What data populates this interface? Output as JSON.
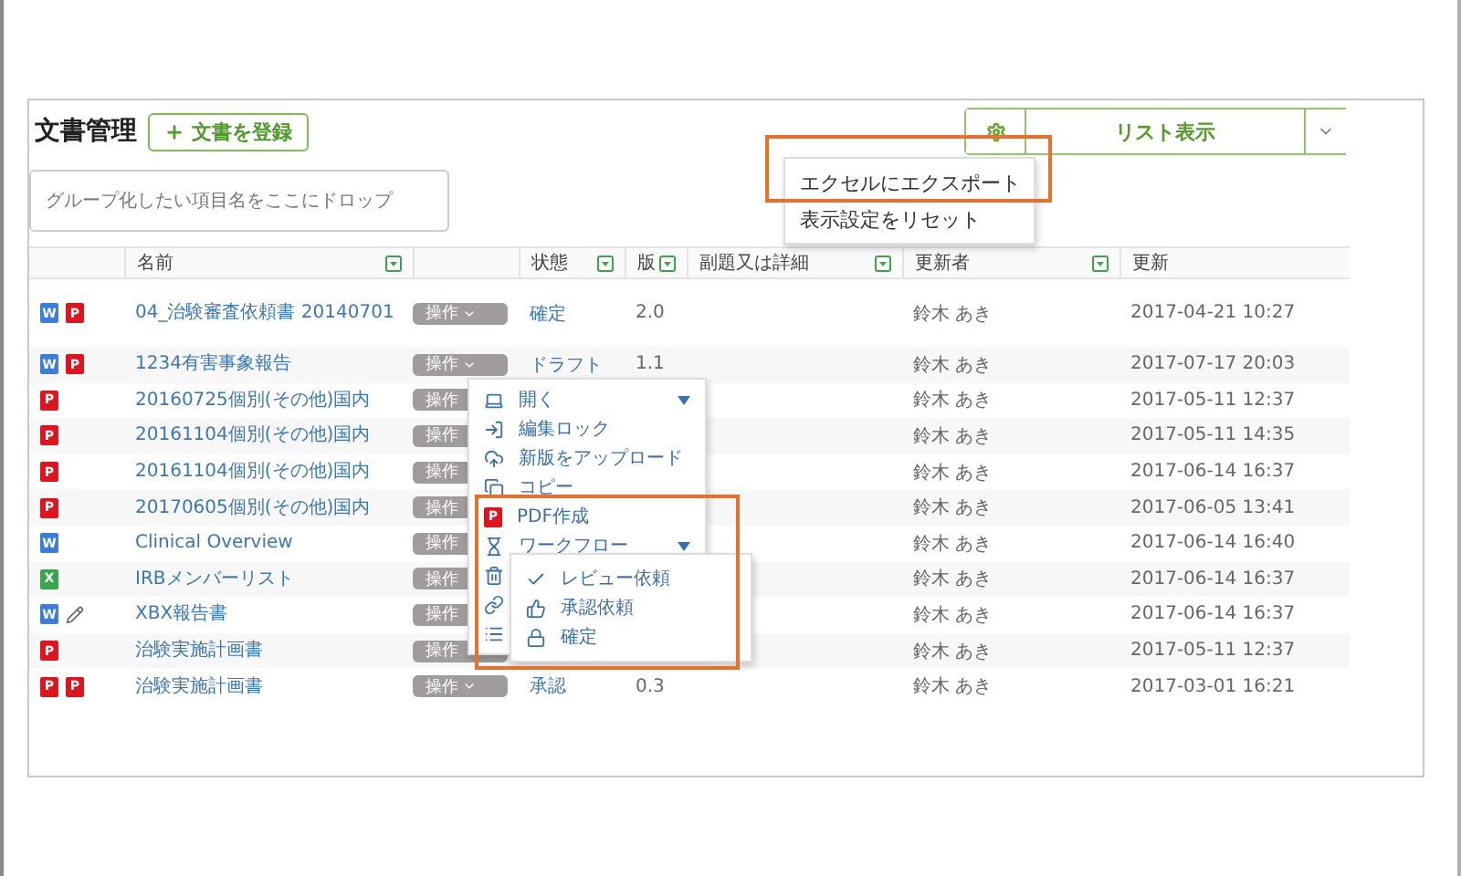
{
  "title": "文書管理",
  "register_button": {
    "label": "文書を登録"
  },
  "view_selector": {
    "label": "リスト表示"
  },
  "view_menu": {
    "items": [
      {
        "label": "エクセルにエクスポート",
        "highlighted": true
      },
      {
        "label": "表示設定をリセット",
        "highlighted": false
      }
    ]
  },
  "group_drop_zone": {
    "placeholder": "グループ化したい項目名をここにドロップ"
  },
  "table": {
    "columns": [
      {
        "filter": false
      },
      {
        "label": "名前",
        "filter": true
      },
      {
        "filter": false
      },
      {
        "label": "状態",
        "filter": true
      },
      {
        "label": "版",
        "filter": true
      },
      {
        "label": "副題又は詳細",
        "filter": true
      },
      {
        "label": "更新者",
        "filter": true
      },
      {
        "label": "更新",
        "filter": false
      }
    ],
    "rows": [
      {
        "files": [
          {
            "kind": "word",
            "letter": "W"
          },
          {
            "kind": "pdf",
            "letter": "P"
          }
        ],
        "name": "04_治験審査依頼書 20140701",
        "action": "操作",
        "status": "確定",
        "version": "2.0",
        "updater": "鈴木 あき",
        "updated": "2017-04-21 10:27"
      },
      {
        "files": [
          {
            "kind": "word",
            "letter": "W"
          },
          {
            "kind": "pdf",
            "letter": "P"
          }
        ],
        "name": "1234有害事象報告",
        "action": "操作",
        "status": "ドラフト",
        "version": "1.1",
        "updater": "鈴木 あき",
        "updated": "2017-07-17 20:03"
      },
      {
        "files": [
          {
            "kind": "pdf",
            "letter": "P"
          }
        ],
        "name": "20160725個別(その他)国内",
        "action": "操作",
        "updater": "鈴木 あき",
        "updated": "2017-05-11 12:37"
      },
      {
        "files": [
          {
            "kind": "pdf",
            "letter": "P"
          }
        ],
        "name": "20161104個別(その他)国内",
        "action": "操作",
        "updater": "鈴木 あき",
        "updated": "2017-05-11 14:35"
      },
      {
        "files": [
          {
            "kind": "pdf",
            "letter": "P"
          }
        ],
        "name": "20161104個別(その他)国内",
        "action": "操作",
        "updater": "鈴木 あき",
        "updated": "2017-06-14 16:37"
      },
      {
        "files": [
          {
            "kind": "pdf",
            "letter": "P"
          }
        ],
        "name": "20170605個別(その他)国内",
        "action": "操作",
        "updater": "鈴木 あき",
        "updated": "2017-06-05 13:41"
      },
      {
        "files": [
          {
            "kind": "word",
            "letter": "W"
          }
        ],
        "name": "Clinical Overview",
        "action": "操作",
        "updater": "鈴木 あき",
        "updated": "2017-06-14 16:40"
      },
      {
        "files": [
          {
            "kind": "excel",
            "letter": "X"
          }
        ],
        "name": "IRBメンバーリスト",
        "action": "操作",
        "updater": "鈴木 あき",
        "updated": "2017-06-14 16:37"
      },
      {
        "files": [
          {
            "kind": "word",
            "letter": "W"
          },
          {
            "kind": "edit"
          }
        ],
        "name": "XBX報告書",
        "action": "操作",
        "updater": "鈴木 あき",
        "updated": "2017-06-14 16:37"
      },
      {
        "files": [
          {
            "kind": "pdf",
            "letter": "P"
          }
        ],
        "name": "治験実施計画書",
        "action": "操作",
        "updater": "鈴木 あき",
        "updated": "2017-05-11 12:37"
      },
      {
        "files": [
          {
            "kind": "pdf",
            "letter": "P"
          },
          {
            "kind": "pdf",
            "letter": "P"
          }
        ],
        "name": "治験実施計画書",
        "action": "操作",
        "status": "承認",
        "version": "0.3",
        "updater": "鈴木 あき",
        "updated": "2017-03-01 16:21"
      }
    ]
  },
  "action_menu": {
    "items": [
      {
        "kind": "open",
        "label": "開く",
        "submenu": true
      },
      {
        "kind": "lock",
        "label": "編集ロック",
        "submenu": false
      },
      {
        "kind": "upload",
        "label": "新版をアップロード",
        "submenu": false
      },
      {
        "kind": "copy",
        "label": "コピー",
        "submenu": false
      },
      {
        "kind": "pdf",
        "label": "PDF作成",
        "letter": "P",
        "submenu": false
      },
      {
        "kind": "workflow",
        "label": "ワークフロー",
        "submenu": true
      },
      {
        "kind": "delete"
      },
      {
        "kind": "link"
      },
      {
        "kind": "list"
      }
    ]
  },
  "workflow_menu": {
    "items": [
      {
        "kind": "review",
        "label": "レビュー依頼"
      },
      {
        "kind": "approve",
        "label": "承認依頼"
      },
      {
        "kind": "confirm",
        "label": "確定"
      }
    ]
  }
}
